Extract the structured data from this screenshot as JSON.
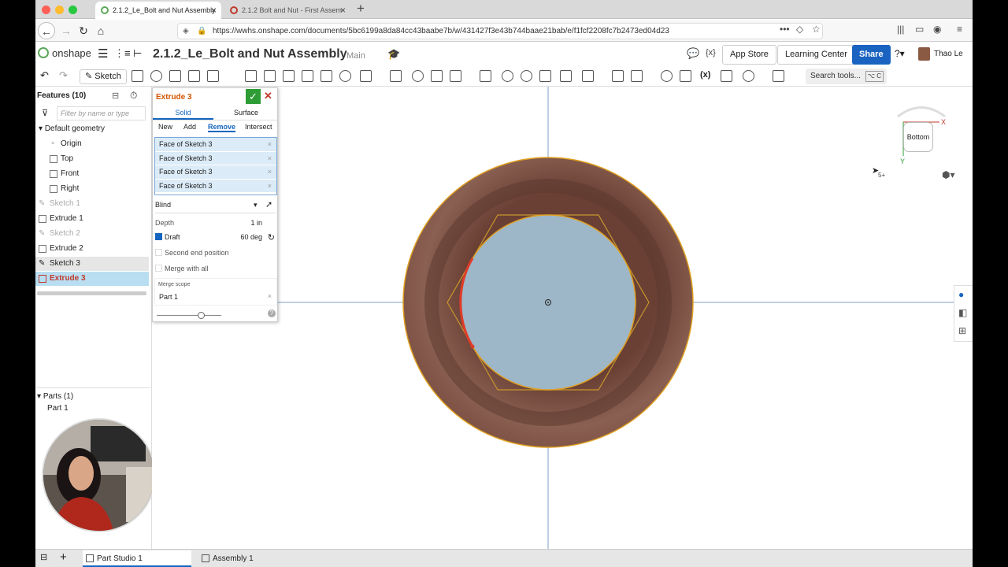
{
  "browser": {
    "tabs": [
      {
        "label": "2.1.2_Le_Bolt and Nut Assembly",
        "active": true
      },
      {
        "label": "2.1.2 Bolt and Nut - First Assem",
        "active": false
      }
    ],
    "url": "https://wwhs.onshape.com/documents/5bc6199a8da84cc43baabe7b/w/431427f3e43b744baae21bab/e/f1fcf2208fc7b2473ed04d23"
  },
  "header": {
    "logo_text": "onshape",
    "doc_name": "2.1.2_Le_Bolt and Nut Assembly",
    "branch": "Main",
    "app_store": "App Store",
    "learning_center": "Learning Center",
    "share": "Share",
    "user": "Thao Le"
  },
  "toolbar": {
    "sketch": "Sketch",
    "search_tools": "Search tools...",
    "search_shortcut": "⌥ C"
  },
  "features": {
    "title": "Features (10)",
    "filter_placeholder": "Filter by name or type",
    "items": [
      "Default geometry",
      "Origin",
      "Top",
      "Front",
      "Right",
      "Sketch 1",
      "Extrude 1",
      "Sketch 2",
      "Extrude 2",
      "Sketch 3",
      "Extrude 3"
    ],
    "parts_title": "Parts (1)",
    "parts": [
      "Part 1"
    ]
  },
  "dialog": {
    "title": "Extrude 3",
    "tabs": [
      "Solid",
      "Surface"
    ],
    "operations": [
      "New",
      "Add",
      "Remove",
      "Intersect"
    ],
    "selections": [
      "Face of Sketch 3",
      "Face of Sketch 3",
      "Face of Sketch 3",
      "Face of Sketch 3"
    ],
    "end_type": "Blind",
    "depth_label": "Depth",
    "depth_value": "1 in",
    "draft_label": "Draft",
    "draft_value": "60 deg",
    "second_end": "Second end position",
    "merge_all": "Merge with all",
    "merge_scope_label": "Merge scope",
    "merge_scope_value": "Part 1"
  },
  "viewport": {
    "view_cube_label": "Bottom",
    "axis_x": "X",
    "axis_y": "Y",
    "cursor_badge": "5+"
  },
  "bottom_tabs": [
    "Part Studio 1",
    "Assembly 1"
  ],
  "colors": {
    "part_fill": "#7a4e40",
    "sketch_fill": "#9db6c8",
    "sketch_line": "#e0a020",
    "selected_edge": "#e03c28",
    "accent": "#1a63c0"
  }
}
